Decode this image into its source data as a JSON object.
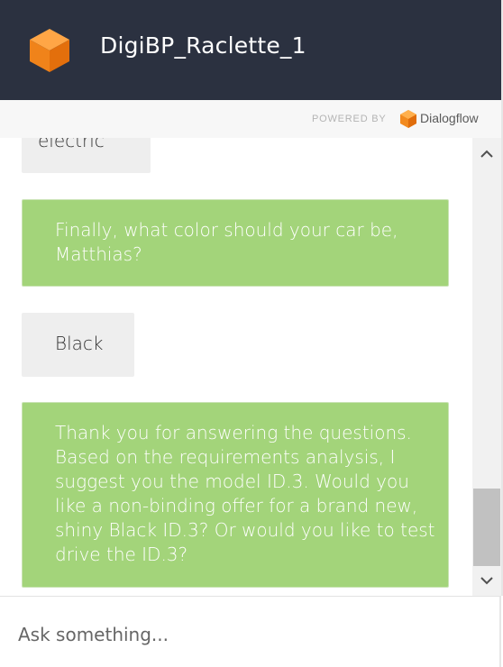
{
  "header": {
    "title": "DigiBP_Raclette_1",
    "logo_icon": "orange-cube-icon",
    "background_color": "#2b3140"
  },
  "powered_by": {
    "label": "POWERED BY",
    "brand": "Dialogflow",
    "brand_icon": "dialogflow-icon"
  },
  "messages": [
    {
      "from": "user",
      "text": "electric"
    },
    {
      "from": "bot",
      "text": "Finally, what color should your car be,\nMatthias?"
    },
    {
      "from": "user",
      "text": "Black"
    },
    {
      "from": "bot",
      "text": "Thank you for answering the questions.\nBased on the requirements analysis, I\nsuggest you the model ID.3. Would you\nlike a non-binding offer for a brand new,\nshiny Black ID.3? Or would you like to test\ndrive the ID.3?"
    }
  ],
  "input": {
    "placeholder": "Ask something...",
    "value": ""
  },
  "colors": {
    "bot_bubble": "#a3d47a",
    "user_bubble": "#eeeeee",
    "brand_orange": "#f28a1e"
  }
}
